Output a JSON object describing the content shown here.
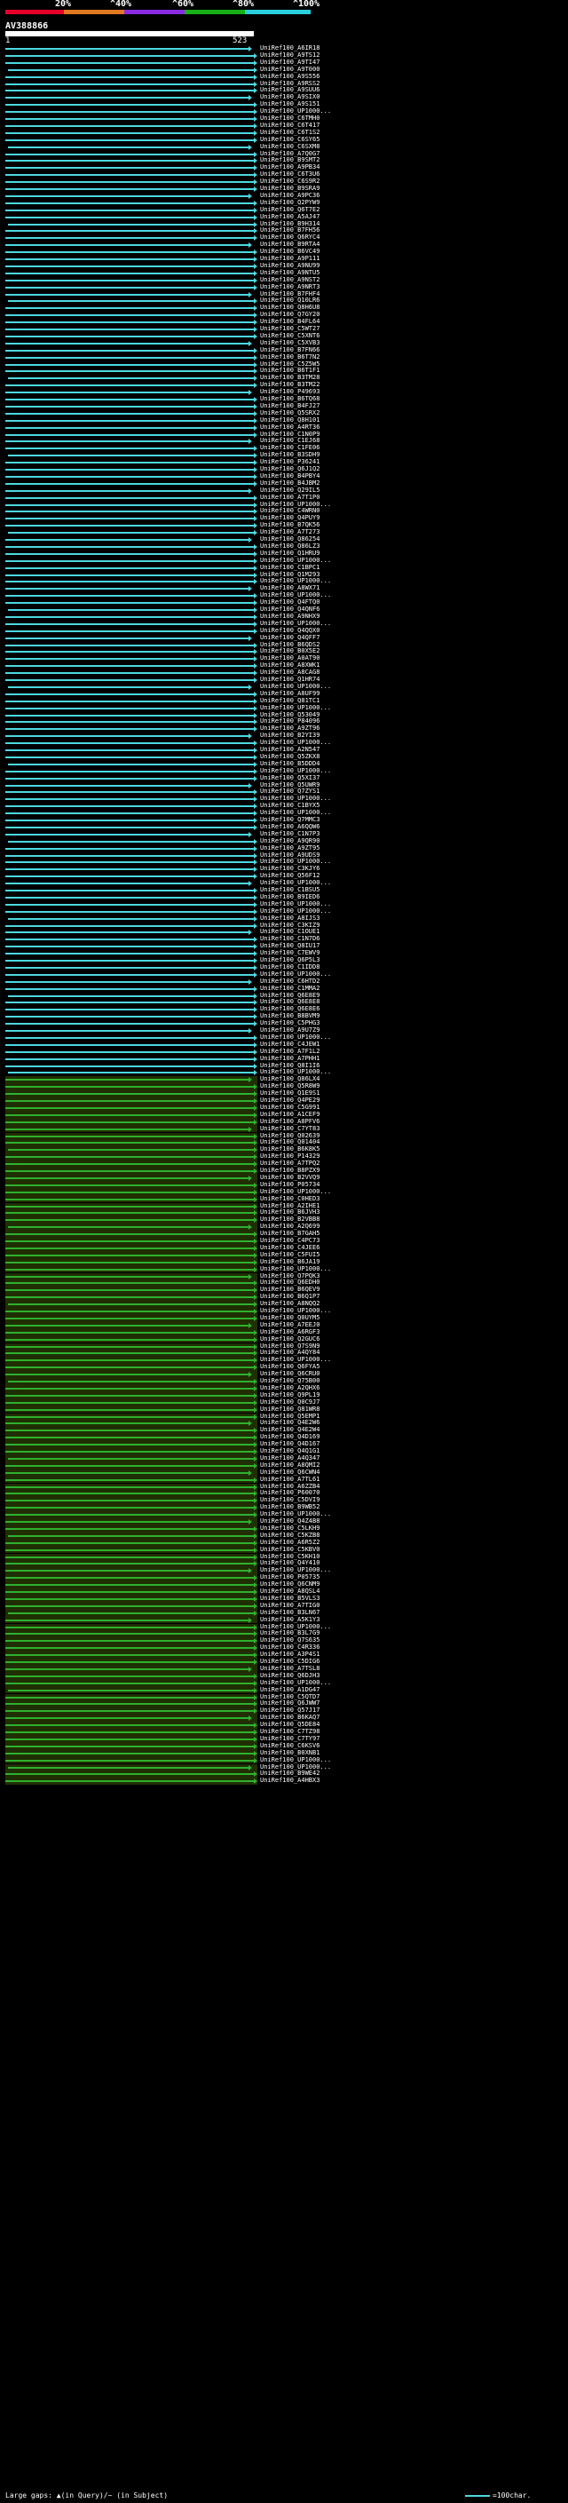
{
  "scale": {
    "labels": [
      "20%",
      "^40%",
      "^60%",
      "^80%",
      "^100%"
    ],
    "colors": [
      "#e8002a",
      "#e07820",
      "#8a2be2",
      "#18b018",
      "#29d0de"
    ]
  },
  "query": {
    "id": "AV388866",
    "start": "1",
    "end": "523"
  },
  "colors": {
    "cyan": "#4dd8e0",
    "green": "#2fb02f",
    "band_green": "#1f2f00",
    "dark": "#06141a"
  },
  "hits": [
    "UniRef100_A6IR18",
    "UniRef100_A9TS12",
    "UniRef100_A9TI47",
    "UniRef100_A9T000",
    "UniRef100_A9S556",
    "UniRef100_A9RSS2",
    "UniRef100_A9SUU6",
    "UniRef100_A9SIX0",
    "UniRef100_A9S151",
    "UniRef100_UP1000...",
    "UniRef100_C6TMH0",
    "UniRef100_C6T417",
    "UniRef100_C6T1S2",
    "UniRef100_C6SY65",
    "UniRef100_C6SXM8",
    "UniRef100_A7Q0G7",
    "UniRef100_B9SMT2",
    "UniRef100_A9PB34",
    "UniRef100_C6T3U6",
    "UniRef100_C6S9R2",
    "UniRef100_B9SRA9",
    "UniRef100_A9PC36",
    "UniRef100_Q2PYW9",
    "UniRef100_Q6T7E2",
    "UniRef100_A5AJ47",
    "UniRef100_B9H314",
    "UniRef100_B7FH56",
    "UniRef100_Q6RYC4",
    "UniRef100_B9RTA4",
    "UniRef100_B6VC49",
    "UniRef100_A9P111",
    "UniRef100_A9NU99",
    "UniRef100_A9NTU5",
    "UniRef100_A9NST2",
    "UniRef100_A9NRT3",
    "UniRef100_B7FHF4",
    "UniRef100_Q10LR6",
    "UniRef100_Q8H6U8",
    "UniRef100_Q7GY20",
    "UniRef100_B4FL64",
    "UniRef100_C5WT27",
    "UniRef100_C5XNT6",
    "UniRef100_C5XVB3",
    "UniRef100_B7FN66",
    "UniRef100_B6T7N2",
    "UniRef100_C5Z5W5",
    "UniRef100_B6T1F1",
    "UniRef100_B3TM28",
    "UniRef100_B3TM22",
    "UniRef100_P49693",
    "UniRef100_B6TQ68",
    "UniRef100_B4FJ27",
    "UniRef100_Q5SRX2",
    "UniRef100_Q8H101",
    "UniRef100_A4RT36",
    "UniRef100_C1N0P9",
    "UniRef100_C1EJ68",
    "UniRef100_C1FE06",
    "UniRef100_B3SDH9",
    "UniRef100_P36241",
    "UniRef100_Q6J1Q2",
    "UniRef100_B4PBY4",
    "UniRef100_B4JBM2",
    "UniRef100_Q29IL5",
    "UniRef100_A7T1P0",
    "UniRef100_UP1000...",
    "UniRef100_C4WRN0",
    "UniRef100_Q4PUY9",
    "UniRef100_B7QK56",
    "UniRef100_A7T273",
    "UniRef100_Q86254",
    "UniRef100_Q86LZ3",
    "UniRef100_Q1HRU9",
    "UniRef100_UP1000...",
    "UniRef100_C1BPC1",
    "UniRef100_Q1M293",
    "UniRef100_UP1000...",
    "UniRef100_A8WX71",
    "UniRef100_UP1000...",
    "UniRef100_Q4FTQ0",
    "UniRef100_Q4QNF6",
    "UniRef100_A9NHX9",
    "UniRef100_UP1000...",
    "UniRef100_Q4QQX0",
    "UniRef100_Q4QFF7",
    "UniRef100_B6QDS2",
    "UniRef100_B0X5E2",
    "UniRef100_A0AT90",
    "UniRef100_A8XWK1",
    "UniRef100_A8CAG8",
    "UniRef100_Q1HR74",
    "UniRef100_UP1000...",
    "UniRef100_A8UF99",
    "UniRef100_Q81TC1",
    "UniRef100_UP1000...",
    "UniRef100_Q53049",
    "UniRef100_P84096",
    "UniRef100_A9ZT96",
    "UniRef100_B2YI39",
    "UniRef100_UP1000...",
    "UniRef100_A2N547",
    "UniRef100_Q5ZKX8",
    "UniRef100_B5DDD4",
    "UniRef100_UP1000...",
    "UniRef100_Q5XI37",
    "UniRef100_Q5UWR9",
    "UniRef100_Q7ZYS1",
    "UniRef100_UP1000...",
    "UniRef100_C1BYX5",
    "UniRef100_UP1000...",
    "UniRef100_Q7MMC3",
    "UniRef100_A6QQW6",
    "UniRef100_C1N7P3",
    "UniRef100_A9QR90",
    "UniRef100_A9ZT95",
    "UniRef100_A9UDS9",
    "UniRef100_UP1000...",
    "UniRef100_C3KJY6",
    "UniRef100_Q56F12",
    "UniRef100_UP1000...",
    "UniRef100_C1BSU5",
    "UniRef100_B9IED6",
    "UniRef100_UP1000...",
    "UniRef100_UP1000...",
    "UniRef100_A8IJS3",
    "UniRef100_C3KIZ9",
    "UniRef100_C1OUE1",
    "UniRef100_C1N7D6",
    "UniRef100_Q8IU17",
    "UniRef100_C7EWV9",
    "UniRef100_Q6P5L3",
    "UniRef100_C1IDD8",
    "UniRef100_UP1000...",
    "UniRef100_C6HTD2",
    "UniRef100_C1MMA2",
    "UniRef100_Q6E8E9",
    "UniRef100_Q6E8E8",
    "UniRef100_Q6E8E6",
    "UniRef100_B8BVM9",
    "UniRef100_C5PHG3",
    "UniRef100_A9U7Z9",
    "UniRef100_UP1000...",
    "UniRef100_C4JEW1",
    "UniRef100_A7F1L2",
    "UniRef100_A7PHH1",
    "UniRef100_Q8I1I6",
    "UniRef100_UP1000...",
    "UniRef100_Q86LX4",
    "UniRef100_Q5R8W9",
    "UniRef100_Q1E9S1",
    "UniRef100_Q4PE29",
    "UniRef100_C5G991",
    "UniRef100_A1CEF9",
    "UniRef100_A8PFV6",
    "UniRef100_C7YT83",
    "UniRef100_Q02639",
    "UniRef100_Q01404",
    "UniRef100_B6K8K5",
    "UniRef100_P14329",
    "UniRef100_A7TPQ2",
    "UniRef100_B8PZX9",
    "UniRef100_B2VVQ9",
    "UniRef100_P05734",
    "UniRef100_UP1000...",
    "UniRef100_C0HED3",
    "UniRef100_A2IHE1",
    "UniRef100_B6JVH3",
    "UniRef100_B2VBB8",
    "UniRef100_A2Q699",
    "UniRef100_B7GAH5",
    "UniRef100_C4PC73",
    "UniRef100_C4JEE6",
    "UniRef100_C5FUI5",
    "UniRef100_B6JA19",
    "UniRef100_UP1000...",
    "UniRef100_Q7PQK3",
    "UniRef100_Q6EDH0",
    "UniRef100_B6QEV9",
    "UniRef100_B6Q1P7",
    "UniRef100_A8NQQ2",
    "UniRef100_UP1000...",
    "UniRef100_Q0UYM5",
    "UniRef100_A7EEJ0",
    "UniRef100_A6RGF3",
    "UniRef100_Q2GUC6",
    "UniRef100_Q7S9N9",
    "UniRef100_A4QY84",
    "UniRef100_UP1000...",
    "UniRef100_Q6FYA5",
    "UniRef100_Q6CRU0",
    "UniRef100_Q75B00",
    "UniRef100_A2QHX6",
    "UniRef100_Q9PL19",
    "UniRef100_Q0C9J7",
    "UniRef100_Q81WR8",
    "UniRef100_Q5EMP1",
    "UniRef100_Q4E2W6",
    "UniRef100_Q4E2W4",
    "UniRef100_Q4D169",
    "UniRef100_Q4D167",
    "UniRef100_Q4Q1G1",
    "UniRef100_A4Q347",
    "UniRef100_A8QMI2",
    "UniRef100_Q6CWN4",
    "UniRef100_A7TL61",
    "UniRef100_A6ZZB4",
    "UniRef100_P60070",
    "UniRef100_C5DVI9",
    "UniRef100_B9WB52",
    "UniRef100_UP1000...",
    "UniRef100_Q4Z4B8",
    "UniRef100_C5LKH9",
    "UniRef100_C5KZB8",
    "UniRef100_A6R5Z2",
    "UniRef100_C5KBV0",
    "UniRef100_C5KH10",
    "UniRef100_Q4Y410",
    "UniRef100_UP1000...",
    "UniRef100_P05735",
    "UniRef100_Q6CNM9",
    "UniRef100_A8QSL4",
    "UniRef100_B5VLS3",
    "UniRef100_A7TIG0",
    "UniRef100_B3LN67",
    "UniRef100_A5K1Y3",
    "UniRef100_UP1000...",
    "UniRef100_B3L7G9",
    "UniRef100_Q7S635",
    "UniRef100_C4R336",
    "UniRef100_A3P4S1",
    "UniRef100_C5DIG6",
    "UniRef100_A7TSL8",
    "UniRef100_Q6DJH3",
    "UniRef100_UP1000...",
    "UniRef100_A1DG47",
    "UniRef100_C5QTD7",
    "UniRef100_Q6JWW7",
    "UniRef100_Q57J17",
    "UniRef100_B6KAQ7",
    "UniRef100_Q5DE84",
    "UniRef100_C7TZ98",
    "UniRef100_C7TY97",
    "UniRef100_C6KSV6",
    "UniRef100_B0XNB1",
    "UniRef100_UP1000...",
    "UniRef100_UP1000...",
    "UniRef100_B9WE42",
    "UniRef100_A4HBX3"
  ],
  "legend": {
    "large_gaps": "Large gaps: ▲(in Query)/~ (in Subject)",
    "scale": "=100char."
  }
}
